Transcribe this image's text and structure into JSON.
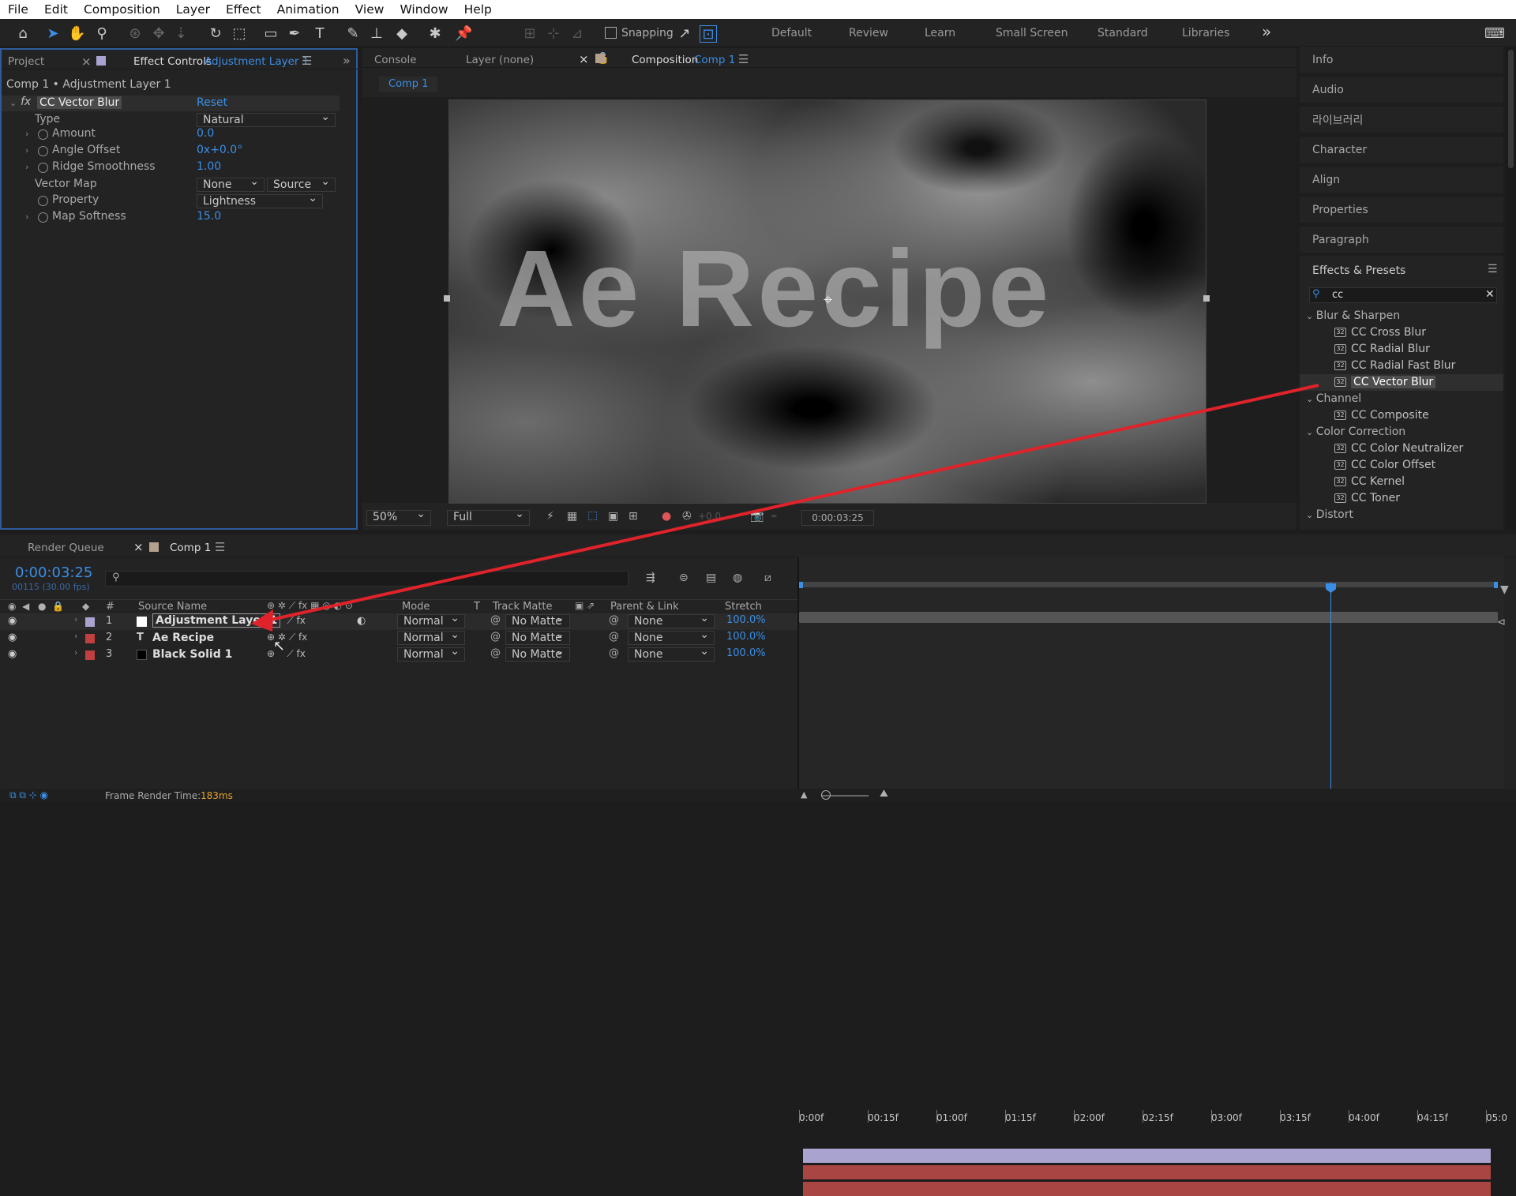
{
  "menu": [
    "File",
    "Edit",
    "Composition",
    "Layer",
    "Effect",
    "Animation",
    "View",
    "Window",
    "Help"
  ],
  "toolbar": {
    "snapping": "Snapping",
    "workspaces": [
      "Default",
      "Review",
      "Learn",
      "Small Screen",
      "Standard",
      "Libraries"
    ],
    "more": "»"
  },
  "left_panel": {
    "tab_project": "Project",
    "tab_effect_controls": "Effect Controls",
    "tab_effect_target": "Adjustment Layer 1",
    "breadcrumb": "Comp 1 • Adjustment Layer 1",
    "effect_name": "CC Vector Blur",
    "reset": "Reset",
    "props": [
      {
        "label": "Type",
        "value": "Natural"
      },
      {
        "label": "Amount",
        "value": "0.0"
      },
      {
        "label": "Angle Offset",
        "value": "0x+0.0°"
      },
      {
        "label": "Ridge Smoothness",
        "value": "1.00"
      },
      {
        "label": "Vector Map",
        "value": "None",
        "value2": "Source"
      },
      {
        "label": "Property",
        "value": "Lightness"
      },
      {
        "label": "Map Softness",
        "value": "15.0"
      }
    ]
  },
  "viewer": {
    "tab_console": "Console",
    "tab_layer": "Layer (none)",
    "tab_comp": "Composition",
    "tab_comp_name": "Comp 1",
    "subtab": "Comp 1",
    "canvas_text": "Ae Recipe",
    "zoom": "50%",
    "resolution": "Full",
    "exposure": "+0.0",
    "timecode": "0:00:03:25"
  },
  "right_panel": {
    "items": [
      "Info",
      "Audio",
      "라이브러리",
      "Character",
      "Align",
      "Properties",
      "Paragraph"
    ],
    "effects_title": "Effects & Presets",
    "search": "cc",
    "groups": [
      {
        "name": "Blur & Sharpen",
        "items": [
          "CC Cross Blur",
          "CC Radial Blur",
          "CC Radial Fast Blur",
          "CC Vector Blur"
        ]
      },
      {
        "name": "Channel",
        "items": [
          "CC Composite"
        ]
      },
      {
        "name": "Color Correction",
        "items": [
          "CC Color Neutralizer",
          "CC Color Offset",
          "CC Kernel",
          "CC Toner"
        ]
      },
      {
        "name": "Distort",
        "items": []
      }
    ]
  },
  "timeline": {
    "tab_render": "Render Queue",
    "tab_comp": "Comp 1",
    "timecode": "0:00:03:25",
    "fps": "00115 (30.00 fps)",
    "headers": {
      "num": "#",
      "source": "Source Name",
      "mode": "Mode",
      "t": "T",
      "track": "Track Matte",
      "parent": "Parent & Link",
      "stretch": "Stretch"
    },
    "ruler": [
      "0:00f",
      "00:15f",
      "01:00f",
      "01:15f",
      "02:00f",
      "02:15f",
      "03:00f",
      "03:15f",
      "04:00f",
      "04:15f",
      "05:0"
    ],
    "layers": [
      {
        "num": "1",
        "name": "Adjustment Layer 1",
        "mode": "Normal",
        "matte": "No Matte",
        "parent": "None",
        "stretch": "100.0%",
        "label": "#a9a3cf",
        "bar": "#a9a3cf",
        "icon": ""
      },
      {
        "num": "2",
        "name": "Ae Recipe",
        "mode": "Normal",
        "matte": "No Matte",
        "parent": "None",
        "stretch": "100.0%",
        "label": "#c0403f",
        "bar": "#a94543",
        "icon": "T"
      },
      {
        "num": "3",
        "name": "Black Solid 1",
        "mode": "Normal",
        "matte": "No Matte",
        "parent": "None",
        "stretch": "100.0%",
        "label": "#c0403f",
        "bar": "#a94543",
        "icon": ""
      }
    ],
    "status_label": "Frame Render Time:",
    "status_value": "183ms"
  }
}
